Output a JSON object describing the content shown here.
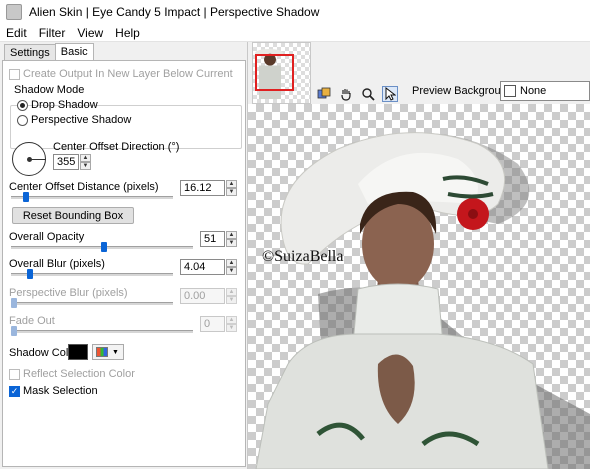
{
  "window": {
    "title": "Alien Skin | Eye Candy 5 Impact | Perspective Shadow"
  },
  "menu": {
    "items": [
      "Edit",
      "Filter",
      "View",
      "Help"
    ]
  },
  "tabs": [
    "Settings",
    "Basic"
  ],
  "settings": {
    "create_output_label": "Create Output In New Layer Below Current",
    "shadow_mode": {
      "legend": "Shadow Mode",
      "options": [
        "Drop Shadow",
        "Perspective Shadow"
      ],
      "selected": "Drop Shadow"
    },
    "center_offset_direction": {
      "label": "Center Offset Direction (°)",
      "value": "355"
    },
    "center_offset_distance": {
      "label": "Center Offset Distance (pixels)",
      "value": "16.12",
      "slider_fraction": 0.08
    },
    "reset_button": "Reset Bounding Box",
    "overall_opacity": {
      "label": "Overall Opacity",
      "value": "51",
      "slider_fraction": 0.51
    },
    "overall_blur": {
      "label": "Overall Blur (pixels)",
      "value": "4.04",
      "slider_fraction": 0.1
    },
    "perspective_blur": {
      "label": "Perspective Blur (pixels)",
      "value": "0.00",
      "slider_fraction": 0.0
    },
    "fade_out": {
      "label": "Fade Out",
      "value": "0",
      "slider_fraction": 0.0
    },
    "shadow_color": {
      "label": "Shadow Color",
      "value": "#000000"
    },
    "reflect_selection_color_label": "Reflect Selection Color",
    "mask_selection_label": "Mask Selection"
  },
  "preview": {
    "background_label": "Preview Background:",
    "background_value": "None",
    "watermark": "©SuizaBella"
  },
  "colors": {
    "accent": "#0a64d6",
    "thumbnail_frame": "#e02020"
  }
}
